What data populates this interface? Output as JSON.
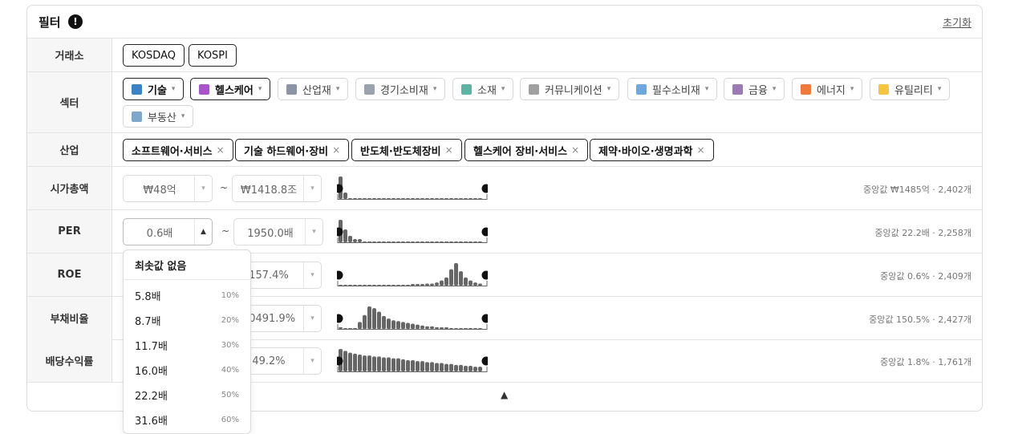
{
  "panel": {
    "title": "필터",
    "info_icon": "!",
    "reset_label": "초기화",
    "collapse_icon": "▲"
  },
  "exchange": {
    "label": "거래소",
    "chips": [
      "KOSDAQ",
      "KOSPI"
    ]
  },
  "sector": {
    "label": "섹터",
    "chips": [
      {
        "label": "기술",
        "icon": "laptop-icon",
        "color": "#3b82c4",
        "selected": true
      },
      {
        "label": "헬스케어",
        "icon": "medical-book-icon",
        "color": "#a855c7",
        "selected": true
      },
      {
        "label": "산업재",
        "icon": "factory-icon",
        "color": "#8a94a6",
        "selected": false
      },
      {
        "label": "경기소비재",
        "icon": "cart-icon",
        "color": "#9aa3ad",
        "selected": false
      },
      {
        "label": "소재",
        "icon": "test-tube-icon",
        "color": "#5fb3a3",
        "selected": false
      },
      {
        "label": "커뮤니케이션",
        "icon": "satellite-icon",
        "color": "#a0a0a0",
        "selected": false
      },
      {
        "label": "필수소비재",
        "icon": "shopping-bag-icon",
        "color": "#6fa8dc",
        "selected": false
      },
      {
        "label": "금융",
        "icon": "bank-icon",
        "color": "#9c7bb5",
        "selected": false
      },
      {
        "label": "에너지",
        "icon": "flame-icon",
        "color": "#f07a3b",
        "selected": false
      },
      {
        "label": "유틸리티",
        "icon": "lightbulb-icon",
        "color": "#f5c542",
        "selected": false
      },
      {
        "label": "부동산",
        "icon": "building-icon",
        "color": "#7fa7c9",
        "selected": false
      }
    ],
    "caret": "▾"
  },
  "industry": {
    "label": "산업",
    "chips": [
      "소프트웨어·서비스",
      "기술 하드웨어·장비",
      "반도체·반도체장비",
      "헬스케어 장비·서비스",
      "제약·바이오·생명과학"
    ],
    "remove": "×"
  },
  "ranges": [
    {
      "key": "mcap",
      "label": "시가총액",
      "min": "₩48억",
      "max": "₩1418.8조",
      "median": "중앙값 ₩1485억 · 2,402개",
      "hist": [
        7,
        2,
        0,
        0,
        0,
        0,
        0,
        0,
        0,
        0,
        0,
        0,
        0,
        0,
        0,
        0,
        0,
        0,
        0,
        0,
        0,
        0,
        0,
        0,
        0,
        0,
        0,
        0,
        0,
        0
      ]
    },
    {
      "key": "per",
      "label": "PER",
      "min": "0.6배",
      "max": "1950.0배",
      "median": "중앙값 22.2배 · 2,258개",
      "hist": [
        7,
        4,
        2,
        1,
        1,
        0,
        0,
        0,
        0,
        0,
        0,
        0,
        0,
        0,
        0,
        0,
        0,
        0,
        0,
        0,
        0,
        0,
        0,
        0,
        0,
        0,
        0,
        0,
        0,
        0
      ]
    },
    {
      "key": "roe",
      "label": "ROE",
      "min": "",
      "max": "157.4%",
      "median": "중앙값 0.6% · 2,409개",
      "hist": [
        0,
        0,
        0,
        0,
        0,
        0,
        0,
        0,
        0,
        0,
        0,
        0,
        0,
        0,
        0,
        1,
        1,
        1,
        2,
        2,
        3,
        5,
        8,
        16,
        22,
        14,
        8,
        5,
        3,
        2
      ]
    },
    {
      "key": "debt",
      "label": "부채비율",
      "min": "",
      "max": "00491.9%",
      "median": "중앙값 150.5% · 2,427개",
      "hist": [
        2,
        0,
        0,
        0,
        8,
        16,
        26,
        24,
        20,
        15,
        12,
        10,
        9,
        8,
        7,
        6,
        5,
        4,
        3,
        3,
        2,
        1,
        1,
        0,
        0,
        0,
        0,
        0,
        0,
        0
      ]
    },
    {
      "key": "div",
      "label": "배당수익률",
      "min": "",
      "max": "49.2%",
      "median": "중앙값 1.8% · 1,761개",
      "hist": [
        24,
        22,
        20,
        19,
        18,
        17,
        17,
        16,
        16,
        15,
        15,
        14,
        14,
        13,
        12,
        12,
        11,
        11,
        10,
        10,
        9,
        9,
        8,
        8,
        7,
        7,
        6,
        6,
        5,
        5
      ]
    }
  ],
  "stepper": {
    "down": "▾",
    "up": "▲"
  },
  "tilde": "~",
  "dropdown": {
    "none_label": "최솟값 없음",
    "options": [
      {
        "value": "5.8배",
        "pct": "10%"
      },
      {
        "value": "8.7배",
        "pct": "20%"
      },
      {
        "value": "11.7배",
        "pct": "30%"
      },
      {
        "value": "16.0배",
        "pct": "40%"
      },
      {
        "value": "22.2배",
        "pct": "50%"
      },
      {
        "value": "31.6배",
        "pct": "60%"
      }
    ]
  }
}
